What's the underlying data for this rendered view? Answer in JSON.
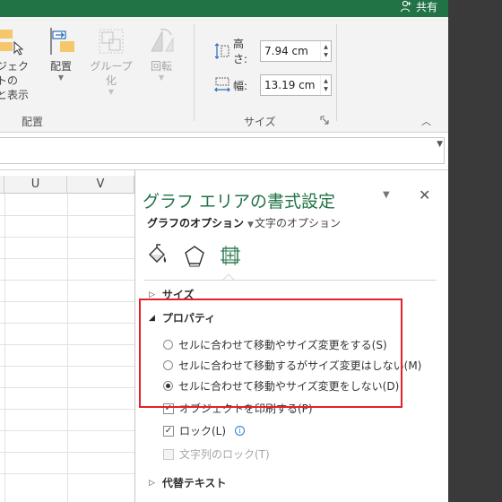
{
  "title_bar": {
    "share_label": "共有"
  },
  "ribbon": {
    "object_btn_label1": "ジェクトの",
    "object_btn_label2": "と表示",
    "arrange_label": "配置",
    "group_label": "グループ化",
    "rotate_label": "回転",
    "arrange_group_label": "配置",
    "size_group_label": "サイズ",
    "height_label": "高さ:",
    "height_value": "7.94 cm",
    "width_label": "幅:",
    "width_value": "13.19 cm"
  },
  "sheet": {
    "columns": [
      "",
      "U",
      "V"
    ]
  },
  "pane": {
    "title": "グラフ エリアの書式設定",
    "tab_graph_options": "グラフのオプション",
    "tab_text_options": "文字のオプション",
    "icons": [
      "fill-line-icon",
      "effects-icon",
      "size-properties-icon"
    ],
    "sections": {
      "size": "サイズ",
      "properties": "プロパティ",
      "alt_text": "代替テキスト"
    },
    "radio_options": [
      {
        "label": "セルに合わせて移動やサイズ変更をする(S)",
        "selected": false
      },
      {
        "label": "セルに合わせて移動するがサイズ変更はしない(M)",
        "selected": false
      },
      {
        "label": "セルに合わせて移動やサイズ変更をしない(D)",
        "selected": true
      }
    ],
    "checkboxes": [
      {
        "label": "オブジェクトを印刷する(P)",
        "checked": true,
        "enabled": true
      },
      {
        "label": "ロック(L)",
        "checked": true,
        "enabled": true
      },
      {
        "label": "文字列のロック(T)",
        "checked": false,
        "enabled": false
      }
    ]
  },
  "colors": {
    "accent": "#217346",
    "highlight": "#e3202a"
  }
}
